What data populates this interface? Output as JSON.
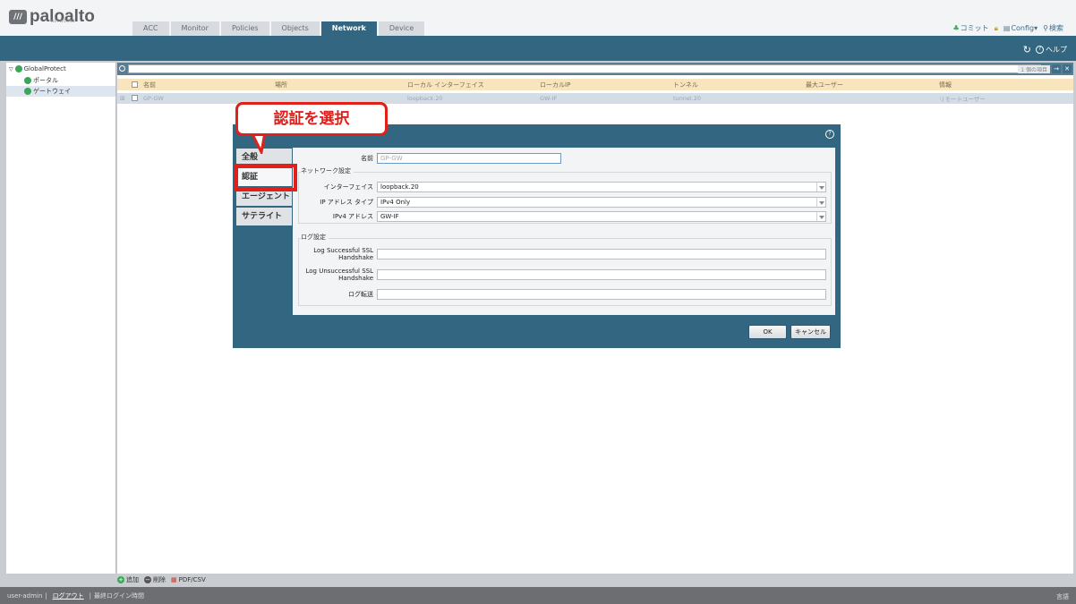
{
  "header": {
    "logo_mark": "///",
    "logo_text": "paloalto",
    "logo_sub": "NETWORKS",
    "tabs": [
      "ACC",
      "Monitor",
      "Policies",
      "Objects",
      "Network",
      "Device"
    ],
    "active_tab": "Network",
    "commit": "コミット",
    "config": "Config▾",
    "search": "検索"
  },
  "band": {
    "help": "ヘルプ"
  },
  "sidebar": {
    "root": "GlobalProtect",
    "items": [
      "ポータル",
      "ゲートウェイ"
    ]
  },
  "main": {
    "search_hint": "1 個の項目",
    "columns": [
      "名前",
      "場所",
      "ローカル インターフェイス",
      "ローカルIP",
      "トンネル",
      "最大ユーザー",
      "情報"
    ],
    "row": [
      "GP-GW",
      "",
      "loopback.20",
      "GW-IF",
      "tunnel.20",
      "",
      "リモートユーザー"
    ],
    "footer": {
      "add": "追加",
      "delete": "削除",
      "pdf": "PDF/CSV"
    }
  },
  "status": {
    "user": "user-admin",
    "logout": "ログアウト",
    "last_login": "最終ログイン時間",
    "lang": "言語"
  },
  "modal": {
    "tabs": [
      "全般",
      "認証",
      "エージェント",
      "サテライト"
    ],
    "active_tab": "認証",
    "name_label": "名前",
    "name_value": "GP-GW",
    "net_group": "ネットワーク設定",
    "interface_label": "インターフェイス",
    "interface_value": "loopback.20",
    "ip_type_label": "IP アドレス タイプ",
    "ip_type_value": "IPv4 Only",
    "ipv4_label": "IPv4 アドレス",
    "ipv4_value": "GW-IF",
    "log_group": "ログ設定",
    "log_ssl_label1": "Log Successful SSL",
    "log_ssl_label2": "Handshake",
    "log_unssl_label1": "Log Unsuccessful SSL",
    "log_unssl_label2": "Handshake",
    "log_forward_label": "ログ転送",
    "ok": "OK",
    "cancel": "キャンセル"
  },
  "annotation": {
    "text": "認証を選択"
  },
  "colors": {
    "accent": "#336680",
    "callout": "#e0201a",
    "table_header": "#f8e5be"
  }
}
